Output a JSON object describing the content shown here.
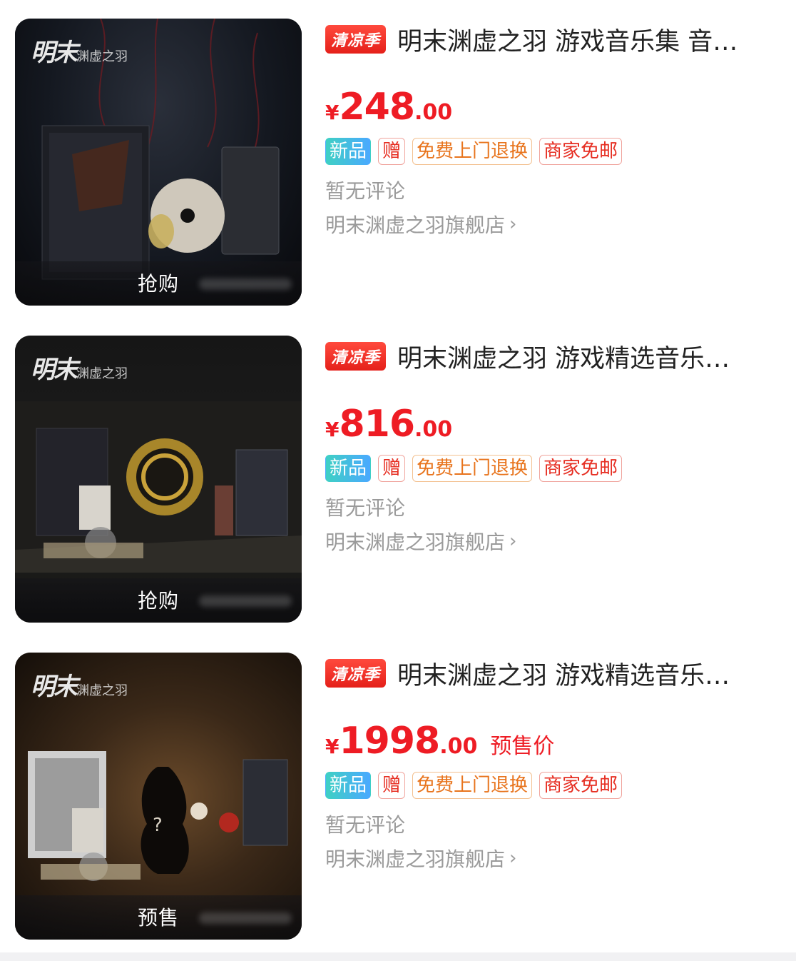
{
  "products": [
    {
      "title": "明末渊虚之羽 游戏音乐集 音…",
      "season_badge": "清凉季",
      "currency": "¥",
      "price_int": "248",
      "price_dec": ".00",
      "price_note": "",
      "tags": {
        "new": "新品",
        "gift": "赠",
        "return": "免费上门退换",
        "shipping": "商家免邮"
      },
      "reviews": "暂无评论",
      "shop": "明末渊虚之羽旗舰店",
      "action": "抢购",
      "logo": "明末",
      "logo_small": "渊虚之羽"
    },
    {
      "title": "明末渊虚之羽 游戏精选音乐…",
      "season_badge": "清凉季",
      "currency": "¥",
      "price_int": "816",
      "price_dec": ".00",
      "price_note": "",
      "tags": {
        "new": "新品",
        "gift": "赠",
        "return": "免费上门退换",
        "shipping": "商家免邮"
      },
      "reviews": "暂无评论",
      "shop": "明末渊虚之羽旗舰店",
      "action": "抢购",
      "logo": "明末",
      "logo_small": "渊虚之羽"
    },
    {
      "title": "明末渊虚之羽 游戏精选音乐…",
      "season_badge": "清凉季",
      "currency": "¥",
      "price_int": "1998",
      "price_dec": ".00",
      "price_note": "预售价",
      "tags": {
        "new": "新品",
        "gift": "赠",
        "return": "免费上门退换",
        "shipping": "商家免邮"
      },
      "reviews": "暂无评论",
      "shop": "明末渊虚之羽旗舰店",
      "action": "预售",
      "logo": "明末",
      "logo_small": "渊虚之羽"
    }
  ],
  "colors": {
    "price": "#ee1c24",
    "muted": "#9a9a9a",
    "title": "#222222"
  },
  "icons": {
    "shop_chevron": "chevron-right-icon"
  }
}
